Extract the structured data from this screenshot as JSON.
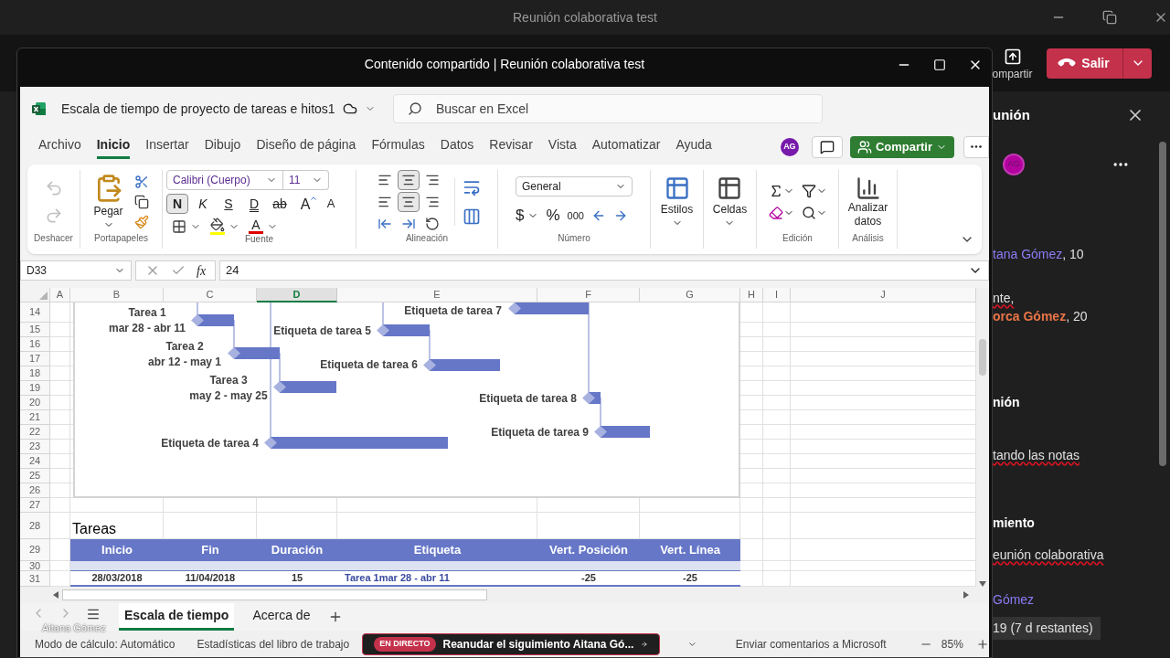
{
  "teams_window": {
    "title": "Reunión colaborativa test"
  },
  "toolbar": {
    "share_label": "ompartir",
    "leave_label": "Salir"
  },
  "shared_window": {
    "title": "Contenido compartido | Reunión colaborativa test"
  },
  "excel": {
    "file_name": "Escala de tiempo de proyecto de tareas e hitos1",
    "search": {
      "placeholder": "Buscar en Excel"
    },
    "menu": [
      {
        "label": "Archivo",
        "selected": false
      },
      {
        "label": "Inicio",
        "selected": true
      },
      {
        "label": "Insertar",
        "selected": false
      },
      {
        "label": "Dibujo",
        "selected": false
      },
      {
        "label": "Diseño de página",
        "selected": false
      },
      {
        "label": "Fórmulas",
        "selected": false
      },
      {
        "label": "Datos",
        "selected": false
      },
      {
        "label": "Revisar",
        "selected": false
      },
      {
        "label": "Vista",
        "selected": false
      },
      {
        "label": "Automatizar",
        "selected": false
      },
      {
        "label": "Ayuda",
        "selected": false
      }
    ],
    "avatar": "AG",
    "share_button": "Compartir",
    "ribbon": {
      "undo": {
        "label": "Deshacer",
        "disabled": true
      },
      "clipboard": {
        "label": "Portapapeles",
        "paste": "Pegar"
      },
      "font": {
        "label": "Fuente",
        "family": "Calibri (Cuerpo)",
        "size": "11",
        "styles": [
          {
            "kind": "bold",
            "label": "N",
            "selected": true
          },
          {
            "kind": "italic",
            "label": "K",
            "selected": false
          },
          {
            "kind": "underline",
            "label": "S",
            "selected": false
          },
          {
            "kind": "double",
            "label": "D",
            "selected": false
          },
          {
            "kind": "strike",
            "label": "ab",
            "selected": false
          }
        ],
        "grow": "A",
        "shrink": "A",
        "color_label": "A"
      },
      "alignment": {
        "label": "Alineación",
        "vertical": [
          {
            "kind": "top",
            "selected": false
          },
          {
            "kind": "middle",
            "selected": true
          },
          {
            "kind": "bottom",
            "selected": false
          }
        ],
        "horizontal": [
          {
            "kind": "left",
            "selected": false
          },
          {
            "kind": "center",
            "selected": true
          },
          {
            "kind": "right",
            "selected": false
          }
        ]
      },
      "number": {
        "label": "Número",
        "format": "General",
        "currency": "$",
        "percent": "%",
        "thousands": "000"
      },
      "styles": "Estilos",
      "cells": "Celdas",
      "editing": "Edición",
      "analysis": {
        "label": "Análisis",
        "button": "Analizar datos"
      }
    },
    "formula_bar": {
      "cell": "D33",
      "function_label": "fx",
      "value": "24"
    },
    "columns": [
      {
        "label": "A",
        "selected": false
      },
      {
        "label": "B",
        "selected": false
      },
      {
        "label": "C",
        "selected": false
      },
      {
        "label": "D",
        "selected": true
      },
      {
        "label": "E",
        "selected": false
      },
      {
        "label": "F",
        "selected": false
      },
      {
        "label": "G",
        "selected": false
      },
      {
        "label": "H",
        "selected": false
      },
      {
        "label": "I",
        "selected": false
      },
      {
        "label": "J",
        "selected": false
      }
    ],
    "rows": [
      "14",
      "15",
      "16",
      "17",
      "18",
      "19",
      "20",
      "21",
      "22",
      "23",
      "24",
      "25",
      "26",
      "27",
      "28",
      "29",
      "30",
      "31"
    ],
    "chart": {
      "tasks": [
        {
          "label": "Tarea 1",
          "dates": "mar 28 - abr 11"
        },
        {
          "label": "Tarea 2",
          "dates": "abr 12 - may 1"
        },
        {
          "label": "Tarea 3",
          "dates": "may 2 - may 25"
        },
        {
          "label": "Etiqueta de tarea 4"
        },
        {
          "label": "Etiqueta de tarea 5"
        },
        {
          "label": "Etiqueta de tarea 6"
        },
        {
          "label": "Etiqueta de tarea 7"
        },
        {
          "label": "Etiqueta de tarea 8"
        },
        {
          "label": "Etiqueta de tarea 9"
        }
      ]
    },
    "table": {
      "title": "Tareas",
      "columns": [
        "Inicio",
        "Fin",
        "Duración",
        "Etiqueta",
        "Vert. Posición",
        "Vert. Línea"
      ],
      "rows": [
        [
          "28/03/2018",
          "11/04/2018",
          "15",
          "Tarea 1mar 28 - abr 11",
          "-25",
          "-25"
        ]
      ]
    },
    "sheets": [
      {
        "label": "Escala de tiempo",
        "selected": true
      },
      {
        "label": "Acerca de",
        "selected": false
      }
    ],
    "status_bar": {
      "calc_mode": "Modo de cálculo: Automático",
      "workbook_stats": "Estadísticas del libro de trabajo",
      "live": {
        "badge": "EN DIRECTO",
        "text": "Reanudar el siguimiento Aitana Gó..."
      },
      "feedback": "Enviar comentarios a Microsoft",
      "zoom": "85%"
    }
  },
  "presenter_name": "Aitana Gómez",
  "side_panel": {
    "title": "unión",
    "avatar": "AG",
    "entries": [
      {
        "kind": "mention",
        "name": "tana Gómez",
        "text": ", 10",
        "color": "#8b7cf6"
      },
      {
        "kind": "text",
        "text": "nte,",
        "misspelled": true
      },
      {
        "kind": "mention",
        "name": "orca Gómez",
        "text": ", 20",
        "color": "#e97548"
      },
      {
        "kind": "heading",
        "text": "nión"
      },
      {
        "kind": "text",
        "text": "tando las notas",
        "misspelled": true
      },
      {
        "kind": "heading",
        "text": "miento"
      },
      {
        "kind": "text",
        "text": "eunión colaborativa",
        "misspelled": true
      },
      {
        "kind": "mention",
        "name": "Gómez",
        "color": "#8b7cf6"
      },
      {
        "kind": "due",
        "text": "19 (7 d restantes)"
      }
    ]
  }
}
